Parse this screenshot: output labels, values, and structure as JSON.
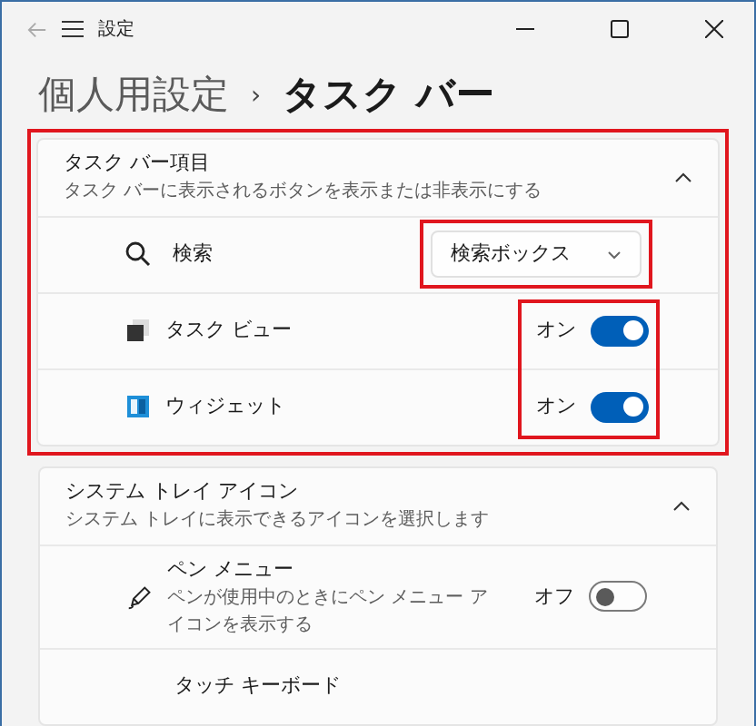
{
  "window": {
    "title": "設定"
  },
  "breadcrumb": {
    "parent": "個人用設定",
    "separator": "›",
    "current": "タスク バー"
  },
  "sections": [
    {
      "title": "タスク バー項目",
      "subtitle": "タスク バーに表示されるボタンを表示または非表示にする",
      "expanded": true,
      "items": [
        {
          "kind": "dropdown",
          "label": "検索",
          "value": "検索ボックス"
        },
        {
          "kind": "toggle",
          "label": "タスク ビュー",
          "state_text": "オン",
          "on": true
        },
        {
          "kind": "toggle",
          "label": "ウィジェット",
          "state_text": "オン",
          "on": true
        }
      ]
    },
    {
      "title": "システム トレイ アイコン",
      "subtitle": "システム トレイに表示できるアイコンを選択します",
      "expanded": true,
      "items": [
        {
          "kind": "toggle",
          "label": "ペン メニュー",
          "description": "ペンが使用中のときにペン メニュー アイコンを表示する",
          "state_text": "オフ",
          "on": false
        },
        {
          "kind": "plain",
          "label": "タッチ キーボード"
        }
      ]
    }
  ]
}
